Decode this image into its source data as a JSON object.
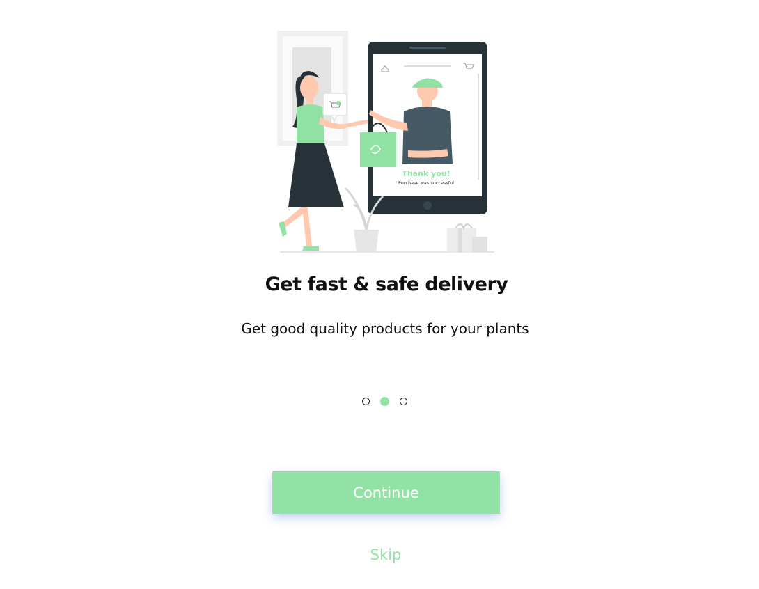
{
  "onboarding": {
    "title": "Get fast & safe delivery",
    "subtitle": "Get good quality products for your plants",
    "illustration": {
      "thank_you_text": "Thank you!",
      "purchase_text": "Purchase was successful"
    },
    "pagination": {
      "total": 3,
      "active_index": 1
    },
    "continue_label": "Continue",
    "skip_label": "Skip"
  },
  "colors": {
    "accent": "#92e2a6",
    "text": "#111111",
    "dark": "#263238"
  }
}
